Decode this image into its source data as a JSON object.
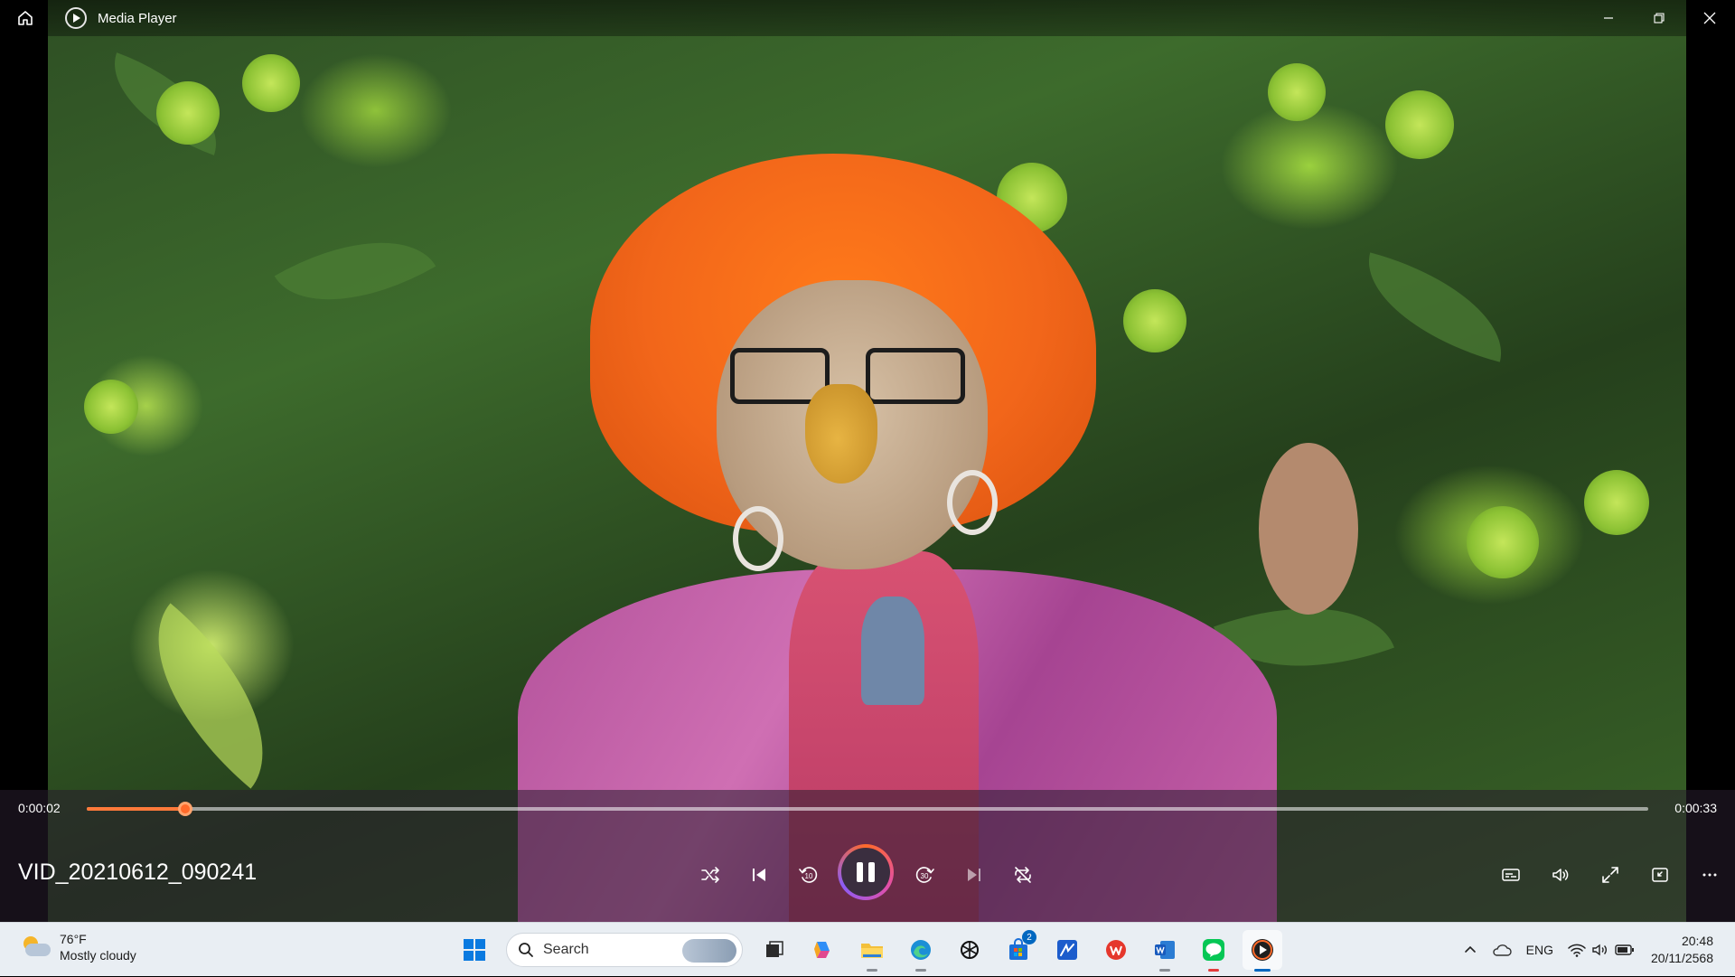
{
  "window": {
    "title": "Media Player"
  },
  "player": {
    "elapsed": "0:00:02",
    "duration": "0:00:33",
    "progress_percent": 6.3,
    "media_title": "VID_20210612_090241",
    "controls": {
      "shuffle": "shuffle-icon",
      "previous": "previous-icon",
      "skip_back_label": "10",
      "play_pause": "pause-icon",
      "skip_forward_label": "30",
      "next": "next-icon",
      "repeat": "repeat-off-icon",
      "captions": "captions-icon",
      "volume": "volume-icon",
      "fullscreen": "fullscreen-icon",
      "miniplayer": "miniplayer-icon",
      "more": "more-icon"
    },
    "accent": "#ff6a2a"
  },
  "taskbar": {
    "weather": {
      "temp": "76°F",
      "condition": "Mostly cloudy"
    },
    "search_label": "Search",
    "store_badge": "2",
    "tray": {
      "language": "ENG"
    },
    "clock": {
      "time": "20:48",
      "date": "20/11/2568"
    }
  }
}
